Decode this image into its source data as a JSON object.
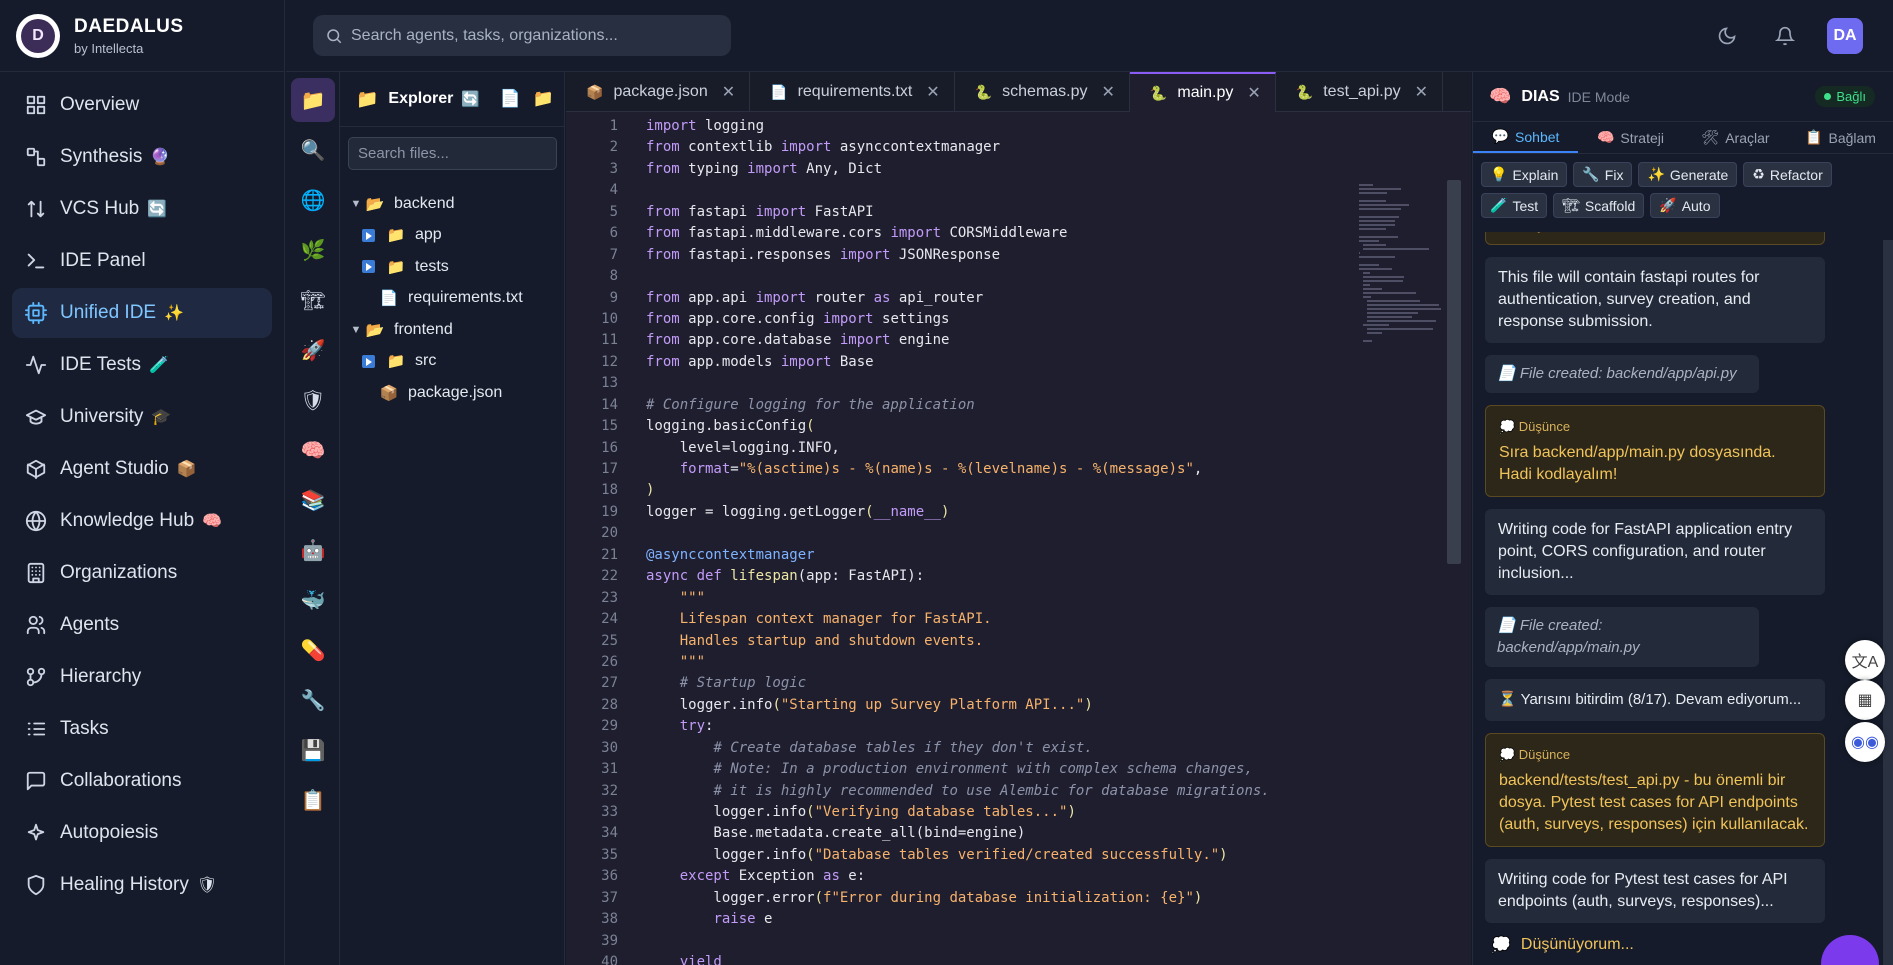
{
  "brand": {
    "title": "DAEDALUS",
    "subtitle": "by Intellecta",
    "logo_letter": "D"
  },
  "nav": {
    "items": [
      {
        "label": "Overview",
        "icon": "grid-icon",
        "emoji": ""
      },
      {
        "label": "Synthesis",
        "icon": "synthesis-icon",
        "emoji": "🔮"
      },
      {
        "label": "VCS Hub",
        "icon": "vcs-icon",
        "emoji": "🔄"
      },
      {
        "label": "IDE Panel",
        "icon": "terminal-icon",
        "emoji": ""
      },
      {
        "label": "Unified IDE",
        "icon": "ide-icon",
        "emoji": "✨"
      },
      {
        "label": "IDE Tests",
        "icon": "pulse-icon",
        "emoji": "🧪"
      },
      {
        "label": "University",
        "icon": "graduation-cap-icon",
        "emoji": "🎓"
      },
      {
        "label": "Agent Studio",
        "icon": "cube-icon",
        "emoji": "📦"
      },
      {
        "label": "Knowledge Hub",
        "icon": "globe-icon",
        "emoji": "🧠"
      },
      {
        "label": "Organizations",
        "icon": "building-icon",
        "emoji": ""
      },
      {
        "label": "Agents",
        "icon": "users-icon",
        "emoji": ""
      },
      {
        "label": "Hierarchy",
        "icon": "branch-icon",
        "emoji": ""
      },
      {
        "label": "Tasks",
        "icon": "list-icon",
        "emoji": ""
      },
      {
        "label": "Collaborations",
        "icon": "chat-icon",
        "emoji": ""
      },
      {
        "label": "Autopoiesis",
        "icon": "sparkles-icon",
        "emoji": ""
      },
      {
        "label": "Healing History",
        "icon": "shield-icon",
        "emoji": "🛡"
      }
    ],
    "active_index": 4
  },
  "header": {
    "search_placeholder": "Search agents, tasks, organizations...",
    "avatar": "DA"
  },
  "activity_bar": [
    "📁",
    "🔍",
    "🌐",
    "🌿",
    "🏗",
    "🚀",
    "🛡",
    "🧠",
    "📚",
    "🤖",
    "🐳",
    "💊",
    "🔧",
    "💾",
    "📋"
  ],
  "explorer": {
    "title": "Explorer",
    "badge": "🔄",
    "search_placeholder": "Search files...",
    "tree": [
      {
        "label": "backend",
        "type": "folder",
        "open": true,
        "depth": 0
      },
      {
        "label": "app",
        "type": "folder",
        "open": false,
        "depth": 1
      },
      {
        "label": "tests",
        "type": "folder",
        "open": false,
        "depth": 1
      },
      {
        "label": "requirements.txt",
        "type": "file",
        "depth": 1
      },
      {
        "label": "frontend",
        "type": "folder",
        "open": true,
        "depth": 0
      },
      {
        "label": "src",
        "type": "folder",
        "open": false,
        "depth": 1
      },
      {
        "label": "package.json",
        "type": "pkg",
        "depth": 1
      }
    ]
  },
  "editor": {
    "tabs": [
      {
        "label": "package.json",
        "icon": "📦",
        "active": false
      },
      {
        "label": "requirements.txt",
        "icon": "📄",
        "active": false
      },
      {
        "label": "schemas.py",
        "icon": "🐍",
        "active": false
      },
      {
        "label": "main.py",
        "icon": "🐍",
        "active": true
      },
      {
        "label": "test_api.py",
        "icon": "🐍",
        "active": false
      }
    ],
    "lines": [
      "<span class=\"kw\">import</span> logging",
      "<span class=\"kw\">from</span> contextlib <span class=\"kw\">import</span> asynccontextmanager",
      "<span class=\"kw\">from</span> typing <span class=\"kw\">import</span> Any, Dict",
      "",
      "<span class=\"kw\">from</span> fastapi <span class=\"kw\">import</span> FastAPI",
      "<span class=\"kw\">from</span> fastapi.middleware.cors <span class=\"kw\">import</span> CORSMiddleware",
      "<span class=\"kw\">from</span> fastapi.responses <span class=\"kw\">import</span> JSONResponse",
      "",
      "<span class=\"kw\">from</span> app.api <span class=\"kw\">import</span> router <span class=\"kw\">as</span> api_router",
      "<span class=\"kw\">from</span> app.core.config <span class=\"kw\">import</span> settings",
      "<span class=\"kw\">from</span> app.core.database <span class=\"kw\">import</span> engine",
      "<span class=\"kw\">from</span> app.models <span class=\"kw\">import</span> Base",
      "",
      "<span class=\"cm\"># Configure logging for the application</span>",
      "logging.basicConfig<span class=\"fn\">(</span>",
      "    level=logging.INFO,",
      "    <span class=\"kw\">format</span>=<span class=\"str\">\"%(asctime)s - %(name)s - %(levelname)s - %(message)s\"</span>,",
      "<span class=\"fn\">)</span>",
      "logger = logging.getLogger<span class=\"fn\">(</span><span class=\"kw\">__name__</span><span class=\"fn\">)</span>",
      "",
      "<span class=\"dec\">@asynccontextmanager</span>",
      "<span class=\"kw\">async def</span> <span class=\"fn\">lifespan</span>(app: FastAPI):",
      "    <span class=\"str\">\"\"\"</span>",
      "    <span class=\"str\">Lifespan context manager for FastAPI.</span>",
      "    <span class=\"str\">Handles startup and shutdown events.</span>",
      "    <span class=\"str\">\"\"\"</span>",
      "    <span class=\"cm\"># Startup logic</span>",
      "    logger.info<span class=\"fn\">(</span><span class=\"str\">\"Starting up Survey Platform API...\"</span><span class=\"fn\">)</span>",
      "    <span class=\"kw\">try</span>:",
      "        <span class=\"cm\"># Create database tables if they don't exist.</span>",
      "        <span class=\"cm\"># Note: In a production environment with complex schema changes,</span>",
      "        <span class=\"cm\"># it is highly recommended to use Alembic for database migrations.</span>",
      "        logger.info<span class=\"fn\">(</span><span class=\"str\">\"Verifying database tables...\"</span><span class=\"fn\">)</span>",
      "        Base.metadata.create_all(bind=engine)",
      "        logger.info<span class=\"fn\">(</span><span class=\"str\">\"Database tables verified/created successfully.\"</span><span class=\"fn\">)</span>",
      "    <span class=\"kw\">except</span> Exception <span class=\"kw\">as</span> e:",
      "        logger.error<span class=\"fn\">(</span><span class=\"str\">f\"Error during database initialization: {e}\"</span><span class=\"fn\">)</span>",
      "        <span class=\"kw\">raise</span> e",
      "",
      "    <span class=\"kw\">yield</span>"
    ]
  },
  "panel": {
    "title": "DIAS",
    "mode": "IDE Mode",
    "status": "Bağlı",
    "tabs": [
      {
        "label": "Sohbet",
        "icon": "💬",
        "active": true
      },
      {
        "label": "Strateji",
        "icon": "🧠",
        "active": false
      },
      {
        "label": "Araçlar",
        "icon": "🛠",
        "active": false
      },
      {
        "label": "Bağlam",
        "icon": "📋",
        "active": false
      }
    ],
    "actions": [
      {
        "label": "Explain",
        "icon": "💡"
      },
      {
        "label": "Fix",
        "icon": "🔧"
      },
      {
        "label": "Generate",
        "icon": "✨"
      },
      {
        "label": "Refactor",
        "icon": "♻"
      },
      {
        "label": "Test",
        "icon": "🧪"
      },
      {
        "label": "Scaffold",
        "icon": "🏗"
      },
      {
        "label": "Auto",
        "icon": "🚀"
      }
    ],
    "messages": [
      {
        "type": "thought-tail",
        "text": "kodlayalım!"
      },
      {
        "type": "text",
        "text": "This file will contain fastapi routes for authentication, survey creation, and response submission."
      },
      {
        "type": "file",
        "text": "📄 File created: backend/app/api.py"
      },
      {
        "type": "thought",
        "label": "💭 Düşünce",
        "text": "Sıra backend/app/main.py dosyasında. Hadi kodlayalım!"
      },
      {
        "type": "text",
        "text": "Writing code for FastAPI application entry point, CORS configuration, and router inclusion..."
      },
      {
        "type": "file",
        "text": "📄 File created: backend/app/main.py"
      },
      {
        "type": "progress",
        "text": "⏳ Yarısını bitirdim (8/17). Devam ediyorum..."
      },
      {
        "type": "thought",
        "label": "💭 Düşünce",
        "text": "backend/tests/test_api.py - bu önemli bir dosya. Pytest test cases for API endpoints (auth, surveys, responses) için kullanılacak."
      },
      {
        "type": "text",
        "text": "Writing code for Pytest test cases for API endpoints (auth, surveys, responses)..."
      }
    ],
    "thinking": "Düşünüyorum..."
  }
}
